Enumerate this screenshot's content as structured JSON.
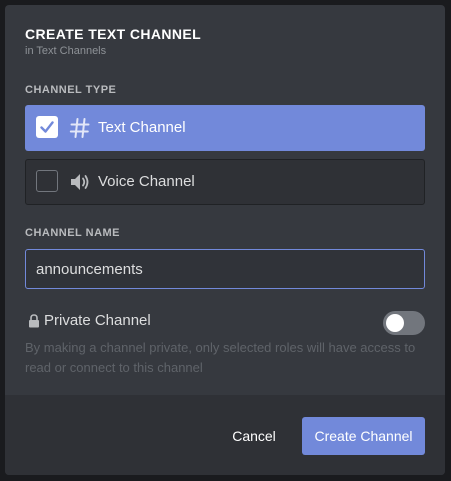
{
  "modal": {
    "title": "CREATE TEXT CHANNEL",
    "subtitle": "in Text Channels"
  },
  "channel_type": {
    "label": "CHANNEL TYPE",
    "options": [
      {
        "label": "Text Channel",
        "icon": "hash-icon",
        "selected": true
      },
      {
        "label": "Voice Channel",
        "icon": "speaker-icon",
        "selected": false
      }
    ]
  },
  "channel_name": {
    "label": "CHANNEL NAME",
    "value": "announcements"
  },
  "private": {
    "label": "Private Channel",
    "enabled": false,
    "description": "By making a channel private, only selected roles will have access to read or connect to this channel"
  },
  "footer": {
    "cancel_label": "Cancel",
    "create_label": "Create Channel"
  },
  "colors": {
    "accent": "#7289da",
    "modal_bg": "#36393f",
    "footer_bg": "#2f3136",
    "toggle_off": "#72767d"
  }
}
